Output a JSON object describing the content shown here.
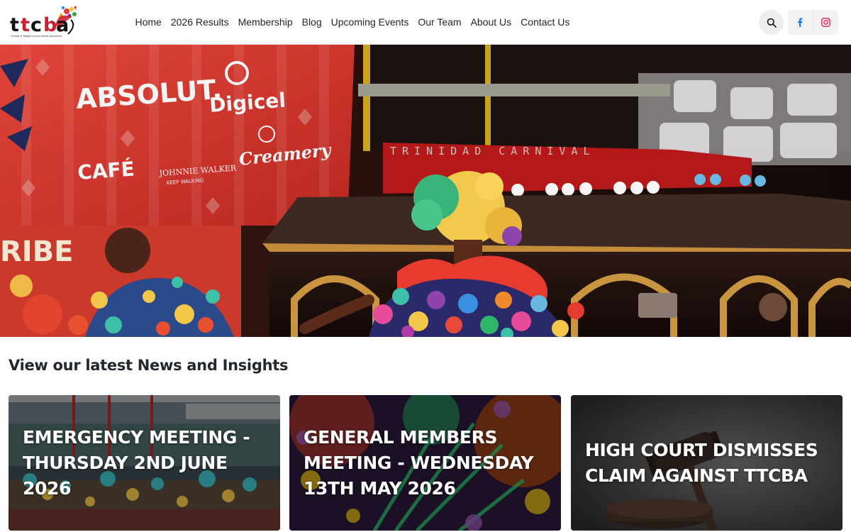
{
  "brand": {
    "logo_text": "ttcba",
    "logo_subtitle": "Trinidad & Tobago Carnival Bands Association"
  },
  "nav": {
    "items": [
      {
        "label": "Home"
      },
      {
        "label": "2026 Results"
      },
      {
        "label": "Membership"
      },
      {
        "label": "Blog"
      },
      {
        "label": "Upcoming Events"
      },
      {
        "label": "Our Team"
      },
      {
        "label": "About Us"
      },
      {
        "label": "Contact Us"
      }
    ]
  },
  "header_actions": {
    "search_icon": "search-icon",
    "facebook_icon": "facebook-icon",
    "instagram_icon": "instagram-icon"
  },
  "hero": {
    "banner_text_1": "ABSOLUT.",
    "banner_text_2": "Digicel",
    "banner_text_3": "JOHNNIE WALKER",
    "banner_text_3b": "KEEP WALKING",
    "banner_text_4": "Creamery",
    "banner_text_5": "CAFÉ",
    "banner_text_6": "RIBE",
    "stage_text": "TRINIDAD CARNIVAL"
  },
  "news": {
    "section_title": "View our latest News and Insights",
    "cards": [
      {
        "title": "EMERGENCY MEETING - THURSDAY 2ND JUNE 2026"
      },
      {
        "title": "GENERAL MEMBERS MEETING - WEDNESDAY 13TH MAY 2026"
      },
      {
        "title": "HIGH COURT DISMISSES CLAIM AGAINST TTCBA"
      }
    ]
  },
  "colors": {
    "logo_red": "#c8202f",
    "logo_black": "#111111",
    "facebook": "#1877f2",
    "instagram": "#e1306c",
    "banner_red": "#d8342c"
  }
}
